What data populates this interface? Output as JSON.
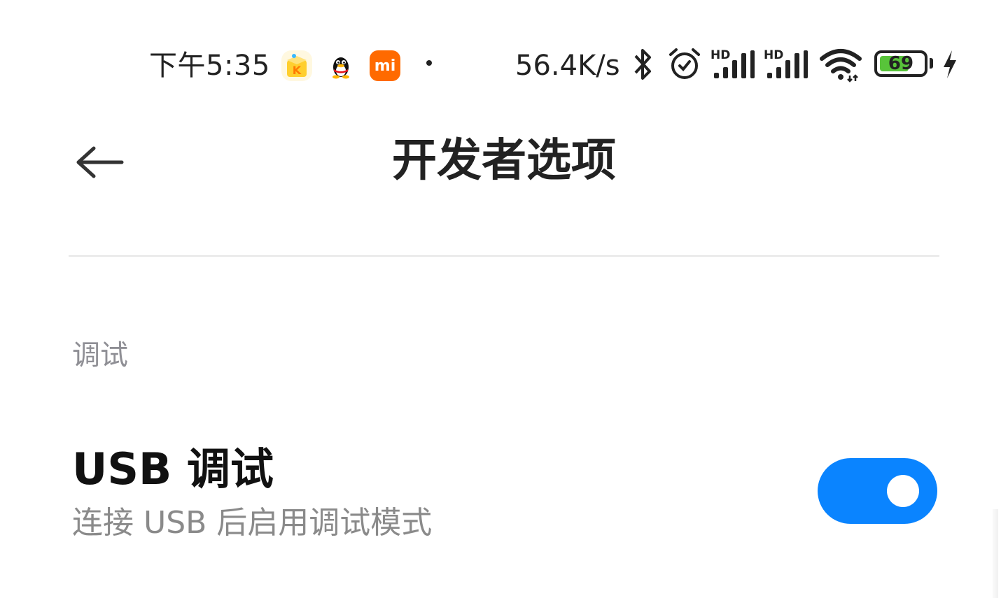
{
  "status_bar": {
    "time": "下午5:35",
    "notification_icons": [
      "kuwo-music-icon",
      "qq-icon",
      "mi-icon"
    ],
    "mi_label": "mi",
    "network_speed": "56.4K/s",
    "sim1_label": "HD",
    "sim2_label": "HD",
    "battery_level": "69",
    "battery_percent": 69,
    "icons": [
      "bluetooth-icon",
      "alarm-icon",
      "signal-sim1-icon",
      "signal-sim2-icon",
      "wifi-icon",
      "battery-icon",
      "charging-icon"
    ]
  },
  "header": {
    "back_icon": "back-arrow-icon",
    "title": "开发者选项"
  },
  "sections": [
    {
      "header": "调试",
      "items": [
        {
          "title": "USB 调试",
          "subtitle": "连接 USB 后启用调试模式",
          "toggle_on": true
        }
      ]
    }
  ],
  "colors": {
    "accent": "#0a84ff",
    "battery_fill": "#58c43a",
    "section_header": "#8f8f95",
    "subtitle": "#8a8a8a"
  }
}
